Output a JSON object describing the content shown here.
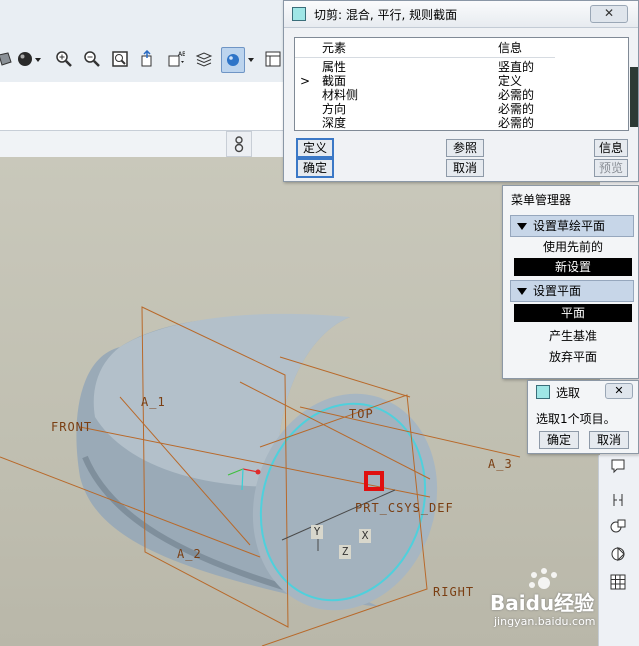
{
  "feature_dialog": {
    "title": "切剪: 混合, 平行, 规则截面",
    "close": "✕",
    "col_element": "元素",
    "col_info": "信息",
    "rows": [
      {
        "element": "属性",
        "info": "竖直的",
        "marker": ""
      },
      {
        "element": "截面",
        "info": "定义",
        "marker": ">"
      },
      {
        "element": "材料侧",
        "info": "必需的",
        "marker": ""
      },
      {
        "element": "方向",
        "info": "必需的",
        "marker": ""
      },
      {
        "element": "深度",
        "info": "必需的",
        "marker": ""
      }
    ],
    "buttons": {
      "define": "定义",
      "reference": "参照",
      "info": "信息",
      "ok": "确定",
      "cancel": "取消",
      "preview": "预览"
    }
  },
  "menu_manager": {
    "title": "菜单管理器",
    "section1": "设置草绘平面",
    "use_previous": "使用先前的",
    "new_setting": "新设置",
    "section2": "设置平面",
    "plane": "平面",
    "create_datum": "产生基准",
    "abandon_plane": "放弃平面"
  },
  "select_dialog": {
    "title": "选取",
    "close": "✕",
    "message": "选取1个项目。",
    "ok": "确定",
    "cancel": "取消"
  },
  "datum_labels": {
    "front": "FRONT",
    "top": "TOP",
    "right": "RIGHT",
    "a1": "A_1",
    "a2": "A_2",
    "a3": "A_3",
    "csys": "PRT_CSYS_DEF",
    "x": "X",
    "y": "Y",
    "z": "Z"
  },
  "watermark": {
    "brand": "Baidu经验",
    "url": "jingyan.baidu.com"
  },
  "colors": {
    "datum_line": "#b8692a",
    "model_body": "#9fb0bd",
    "edge_highlight": "#4fd0dc",
    "pick_marker": "#e01010",
    "selection_bg": "#000000"
  }
}
